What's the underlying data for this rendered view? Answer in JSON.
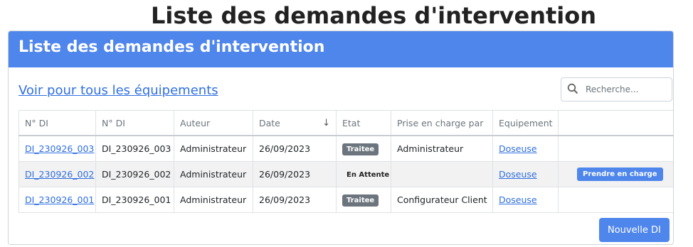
{
  "page_title": "Liste des demandes d'intervention",
  "card": {
    "header": "Liste des demandes d'intervention",
    "all_link": "Voir pour tous les équipements",
    "search_placeholder": "Recherche...",
    "new_button": "Nouvelle DI"
  },
  "table": {
    "headers": [
      "N° DI",
      "N° DI",
      "Auteur",
      "Date",
      "Etat",
      "Prise en charge par",
      "Equipement",
      ""
    ],
    "rows": [
      {
        "di_link": "DI_230926_003",
        "di": "DI_230926_003",
        "auteur": "Administrateur",
        "date": "26/09/2023",
        "etat": "Traitee",
        "prise": "Administrateur",
        "equipement": "Doseuse",
        "action": ""
      },
      {
        "di_link": "DI_230926_002",
        "di": "DI_230926_002",
        "auteur": "Administrateur",
        "date": "26/09/2023",
        "etat": "En Attente",
        "prise": "",
        "equipement": "Doseuse",
        "action": "Prendre en charge"
      },
      {
        "di_link": "DI_230926_001",
        "di": "DI_230926_001",
        "auteur": "Administrateur",
        "date": "26/09/2023",
        "etat": "Traitee",
        "prise": "Configurateur Client",
        "equipement": "Doseuse",
        "action": ""
      }
    ]
  },
  "colors": {
    "primary": "#4f86ec",
    "badge_grey": "#6c757d",
    "link": "#2f6fe0"
  },
  "icons": {
    "search": "search-icon",
    "sort": "sort-down-arrow-icon"
  }
}
